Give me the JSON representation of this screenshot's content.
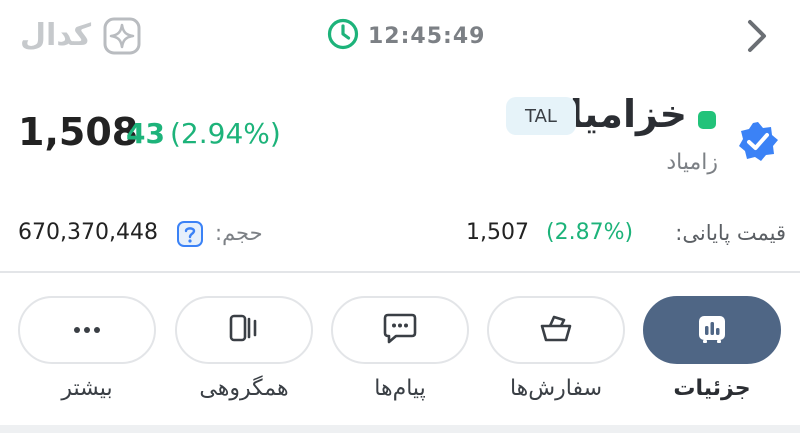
{
  "header": {
    "logo": "کدال",
    "time": "12:45:49"
  },
  "symbol": {
    "name": "خزامیا",
    "tag": "TAL",
    "company": "زامیاد",
    "last_price": "1,508",
    "change_abs": "43",
    "change_pct": "(2.94%)"
  },
  "stats": {
    "volume_label": "حجم:",
    "volume_value": "670,370,448",
    "close_label": "قیمت پایانی:",
    "close_value": "1,507",
    "close_pct": "(2.87%)"
  },
  "tabs": [
    {
      "label": "جزئیات",
      "icon": "chart-icon",
      "active": true
    },
    {
      "label": "سفارش‌ها",
      "icon": "basket-icon",
      "active": false
    },
    {
      "label": "پیام‌ها",
      "icon": "message-icon",
      "active": false
    },
    {
      "label": "همگروهی",
      "icon": "compare-icon",
      "active": false
    },
    {
      "label": "بیشتر",
      "icon": "more-icon",
      "active": false
    }
  ],
  "colors": {
    "positive": "#1db37a",
    "active_tab": "#4f6685",
    "status_dot": "#22c37a",
    "verified": "#3b82f6"
  }
}
